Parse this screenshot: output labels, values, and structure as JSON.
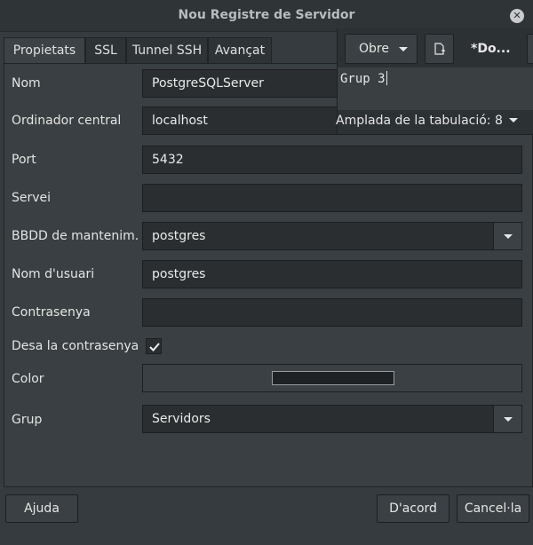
{
  "window": {
    "title": "Nou Registre de Servidor"
  },
  "tabs": [
    {
      "label": "Propietats",
      "active": true
    },
    {
      "label": "SSL"
    },
    {
      "label": "Tunnel SSH"
    },
    {
      "label": "Avançat"
    }
  ],
  "form": {
    "nom": {
      "label": "Nom",
      "value": "PostgreSQLServer"
    },
    "host": {
      "label": "Ordinador central",
      "value": "localhost"
    },
    "port": {
      "label": "Port",
      "value": "5432"
    },
    "servei": {
      "label": "Servei",
      "value": ""
    },
    "bbdd": {
      "label": "BBDD de mantenim.",
      "value": "postgres"
    },
    "usuari": {
      "label": "Nom d'usuari",
      "value": "postgres"
    },
    "contrasenya": {
      "label": "Contrasenya",
      "value": ""
    },
    "desa": {
      "label": "Desa la contrasenya",
      "checked": true
    },
    "color": {
      "label": "Color",
      "swatch": "#1e2224"
    },
    "grup": {
      "label": "Grup",
      "value": "Servidors"
    }
  },
  "buttons": {
    "help": "Ajuda",
    "ok": "D'acord",
    "cancel": "Cancel·la"
  },
  "editor": {
    "open": "Obre",
    "doc_title": "*Do...",
    "text": "Grup 3",
    "status": "Amplada de la tabulació: 8"
  }
}
